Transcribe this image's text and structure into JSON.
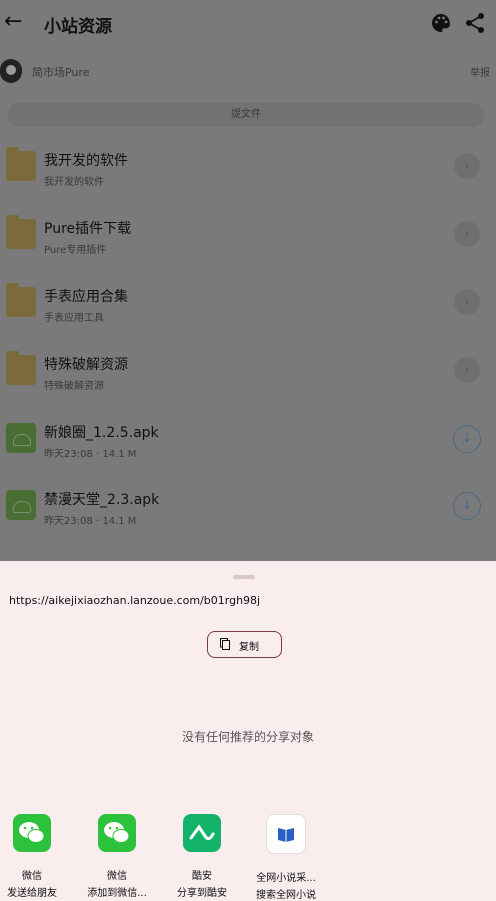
{
  "header": {
    "title": "小站资源",
    "back_icon": "arrow-left-icon",
    "palette_icon": "palette-icon",
    "share_icon": "share-icon"
  },
  "author": {
    "name": "简市场Pure",
    "report_label": "举报"
  },
  "submit_label": "提文件",
  "files": [
    {
      "name": "我开发的软件",
      "sub": "我开发的软件",
      "kind": "folder"
    },
    {
      "name": "Pure插件下载",
      "sub": "Pure专用插件",
      "kind": "folder"
    },
    {
      "name": "手表应用合集",
      "sub": "手表应用工具",
      "kind": "folder"
    },
    {
      "name": "特殊破解资源",
      "sub": "特殊破解资源",
      "kind": "folder"
    },
    {
      "name": "新娘圈_1.2.5.apk",
      "sub": "昨天23:08 · 14.1 M",
      "kind": "apk"
    },
    {
      "name": "禁漫天堂_2.3.apk",
      "sub": "昨天23:08 · 14.1 M",
      "kind": "apk"
    }
  ],
  "sheet": {
    "url": "https://aikejixiaozhan.lanzoue.com/b01rgh98j",
    "copy_label": "复制",
    "empty_text": "没有任何推荐的分享对象",
    "targets": [
      {
        "line1": "微信",
        "line2": "发送给朋友",
        "icon": "wechat-icon"
      },
      {
        "line1": "微信",
        "line2": "添加到微信...",
        "icon": "wechat-icon"
      },
      {
        "line1": "酷安",
        "line2": "分享到酷安",
        "icon": "coolapk-icon"
      },
      {
        "line1": "全网小说采...",
        "line2": "搜索全网小说",
        "icon": "book-icon"
      }
    ]
  },
  "colors": {
    "scrim": "#7a7a7a",
    "sheet_bg": "#faeded",
    "accent": "#7a3a4a",
    "wechat": "#2dc23c",
    "coolapk": "#13b36a"
  }
}
